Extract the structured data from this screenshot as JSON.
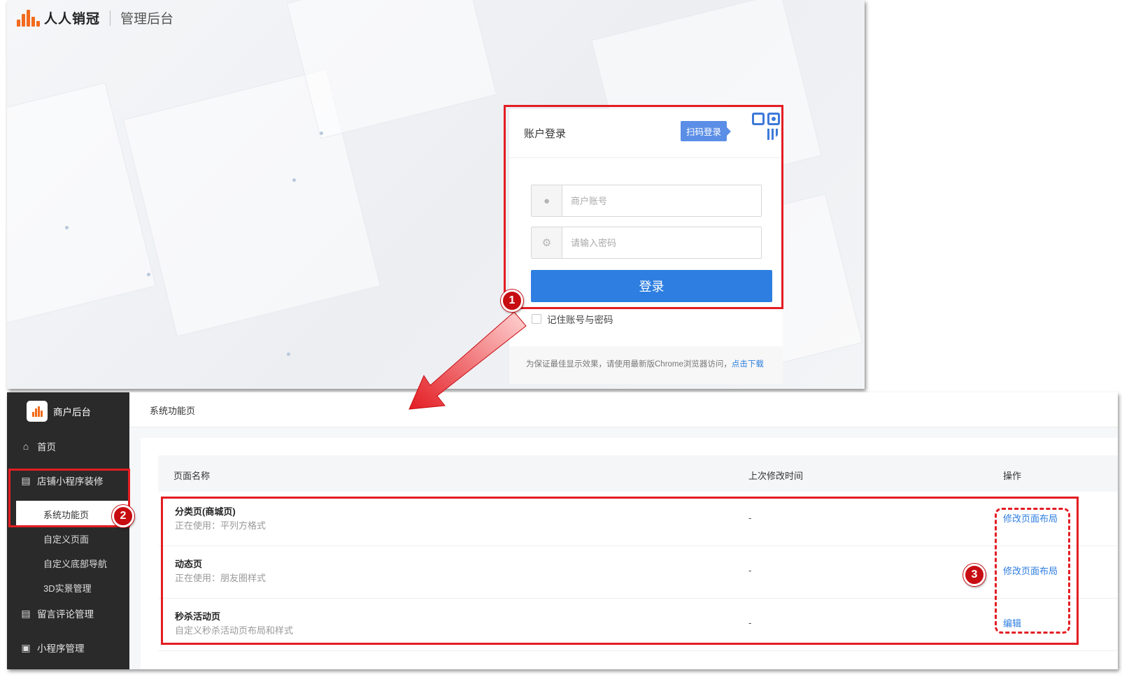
{
  "login_page": {
    "brand_name": "人人销冠",
    "brand_subtitle": "管理后台",
    "login_title": "账户登录",
    "qr_login_tip": "扫码登录",
    "account_placeholder": "商户账号",
    "password_placeholder": "请输入密码",
    "login_button": "登录",
    "remember_label": "记住账号与密码",
    "footer_text": "为保证最佳显示效果，请使用最新版Chrome浏览器访问，",
    "footer_link": "点击下载"
  },
  "admin": {
    "sidebar_title": "商户后台",
    "nav": {
      "home": "首页",
      "shop_decor": "店铺小程序装修",
      "sub_system": "系统功能页",
      "sub_custom_page": "自定义页面",
      "sub_bottom_nav": "自定义底部导航",
      "sub_3d": "3D实景管理",
      "comments": "留言评论管理",
      "miniapp": "小程序管理"
    },
    "header_title": "系统功能页",
    "table": {
      "col_name": "页面名称",
      "col_time": "上次修改时间",
      "col_ops": "操作",
      "rows": [
        {
          "name": "分类页(商城页)",
          "desc": "正在使用：平列方格式",
          "time": "-",
          "op": "修改页面布局"
        },
        {
          "name": "动态页",
          "desc": "正在使用：朋友圈样式",
          "time": "-",
          "op": "修改页面布局"
        },
        {
          "name": "秒杀活动页",
          "desc": "自定义秒杀活动页布局和样式",
          "time": "-",
          "op": "编辑"
        }
      ]
    }
  },
  "annotations": {
    "badge_1": "1",
    "badge_2": "2",
    "badge_3": "3"
  },
  "colors": {
    "accent": "#2d7ee0",
    "highlight": "#e31d23",
    "brand": "#f26a1b",
    "sidebar": "#2a2a2a"
  },
  "icons": [
    "logo-icon",
    "qr-code-icon",
    "user-icon",
    "key-icon",
    "home-icon",
    "brush-icon",
    "comment-icon",
    "miniapp-icon"
  ]
}
